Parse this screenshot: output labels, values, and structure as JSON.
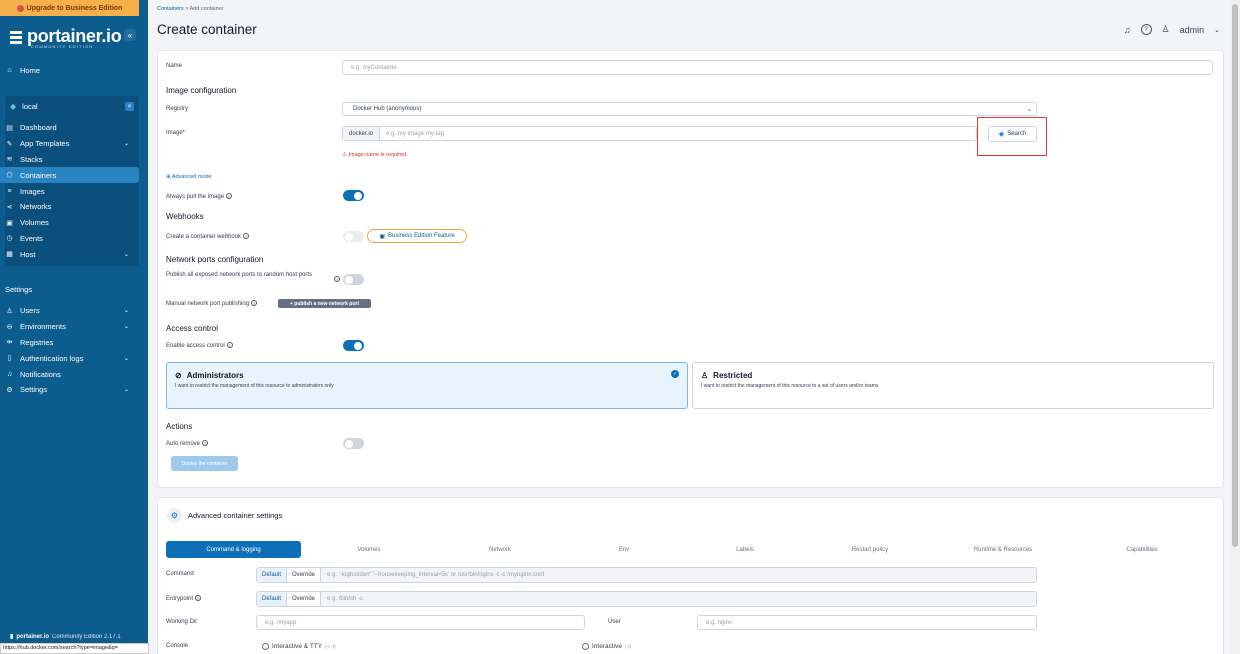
{
  "upgrade_banner": "Upgrade to Business Edition",
  "logo": {
    "name": "portainer.io",
    "edition": "COMMUNITY EDITION"
  },
  "sidebar": {
    "home": "Home",
    "environment": "local",
    "env_items": [
      {
        "label": "Dashboard",
        "icon": "dashboard-icon"
      },
      {
        "label": "App Templates",
        "icon": "edit-icon"
      },
      {
        "label": "Stacks",
        "icon": "stacks-icon"
      },
      {
        "label": "Containers",
        "icon": "container-icon"
      },
      {
        "label": "Images",
        "icon": "list-icon"
      },
      {
        "label": "Networks",
        "icon": "network-icon"
      },
      {
        "label": "Volumes",
        "icon": "database-icon"
      },
      {
        "label": "Events",
        "icon": "clock-icon"
      },
      {
        "label": "Host",
        "icon": "server-icon"
      }
    ],
    "settings_title": "Settings",
    "settings_items": [
      {
        "label": "Users"
      },
      {
        "label": "Environments"
      },
      {
        "label": "Registries"
      },
      {
        "label": "Authentication logs"
      },
      {
        "label": "Notifications"
      },
      {
        "label": "Settings"
      }
    ],
    "footer_brand": "portainer.io",
    "footer_version": "Community Edition 2.17.1"
  },
  "status_url": "https://hub.docker.com/search?type=image&q=",
  "breadcrumb": {
    "root": "Containers",
    "current": "Add container"
  },
  "page_title": "Create container",
  "user": "admin",
  "form": {
    "name_label": "Name",
    "name_placeholder": "e.g. myContainer",
    "image_config_title": "Image configuration",
    "registry_label": "Registry",
    "registry_value": "Docker Hub (anonymous)",
    "image_label": "Image*",
    "image_prefix": "docker.io",
    "image_placeholder": "e.g. my-image:my-tag",
    "search_label": "Search",
    "image_error": "Image name is required.",
    "advanced_mode": "Advanced mode",
    "always_pull_label": "Always pull the image",
    "webhooks_title": "Webhooks",
    "webhook_label": "Create a container webhook",
    "business_feature": "Business Edition Feature",
    "network_ports_title": "Network ports configuration",
    "publish_all_label": "Publish all exposed network ports to random host ports",
    "manual_publish_label": "Manual network port publishing",
    "publish_new_label": "+ publish a new network port",
    "access_control_title": "Access control",
    "enable_access_label": "Enable access control",
    "admins_title": "Administrators",
    "admins_desc": "I want to restrict the management of this resource to administrators only",
    "restricted_title": "Restricted",
    "restricted_desc": "I want to restrict the management of this resource to a set of users and/or teams",
    "actions_title": "Actions",
    "auto_remove_label": "Auto remove",
    "deploy_label": "Deploy the container"
  },
  "advanced": {
    "title": "Advanced container settings",
    "tabs": [
      "Command & logging",
      "Volumes",
      "Network",
      "Env",
      "Labels",
      "Restart policy",
      "Runtime & Resources",
      "Capabilities"
    ],
    "command_label": "Command",
    "default_label": "Default",
    "override_label": "Override",
    "command_placeholder": "e.g. '-logtostderr' '--housekeeping_interval=5s' or /usr/bin/nginx -t -c /mynginx.conf",
    "entrypoint_label": "Entrypoint",
    "entrypoint_placeholder": "e.g. /bin/sh -c",
    "workdir_label": "Working Dir",
    "workdir_placeholder": "e.g. /myapp",
    "user_label": "User",
    "user_placeholder": "e.g. nginx",
    "console_label": "Console",
    "console_opt1": "Interactive & TTY",
    "console_opt1_hint": "(-i -t)",
    "console_opt2": "Interactive",
    "console_opt2_hint": "(-i)"
  }
}
